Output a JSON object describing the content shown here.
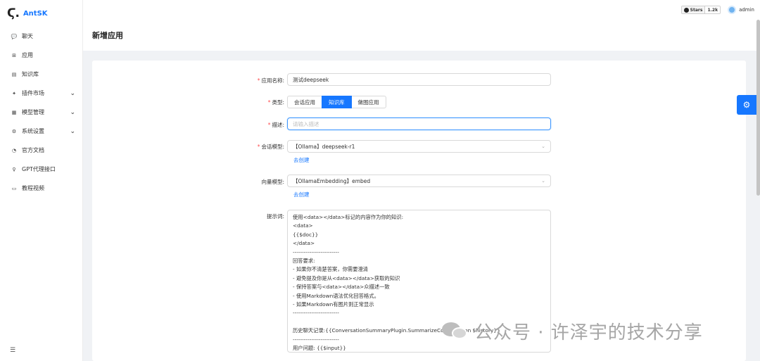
{
  "app": {
    "logo_mark": "Ϛ.",
    "name": "AntSK"
  },
  "sidebar": {
    "items": [
      {
        "icon": "chat-icon",
        "glyph": "💬",
        "label": "聊天",
        "expandable": false
      },
      {
        "icon": "app-icon",
        "glyph": "⊞",
        "label": "应用",
        "expandable": false
      },
      {
        "icon": "book-icon",
        "glyph": "▤",
        "label": "知识库",
        "expandable": false
      },
      {
        "icon": "plugin-icon",
        "glyph": "✦",
        "label": "插件市场",
        "expandable": true
      },
      {
        "icon": "model-icon",
        "glyph": "▦",
        "label": "模型管理",
        "expandable": true
      },
      {
        "icon": "gear-icon",
        "glyph": "⚙",
        "label": "系统设置",
        "expandable": true
      },
      {
        "icon": "doc-icon",
        "glyph": "◔",
        "label": "官方文档",
        "expandable": false
      },
      {
        "icon": "bulb-icon",
        "glyph": "♀",
        "label": "GPT代理接口",
        "expandable": false
      },
      {
        "icon": "video-icon",
        "glyph": "▭",
        "label": "教程视频",
        "expandable": false
      }
    ],
    "collapse_glyph": "☰"
  },
  "header": {
    "github": {
      "label": "Stars",
      "count": "1.2k"
    },
    "user": "admin"
  },
  "page": {
    "title": "新增应用"
  },
  "form": {
    "name": {
      "label": "应用名称:",
      "value": "测试deepseek"
    },
    "type": {
      "label": "类型:",
      "options": [
        "会话应用",
        "知识库",
        "做图应用"
      ],
      "selected": "知识库"
    },
    "desc": {
      "label": "描述:",
      "placeholder": "请输入描述"
    },
    "chat_model": {
      "label": "会话模型:",
      "value": "【Ollama】deepseek-r1",
      "create_link": "去创建"
    },
    "embed_model": {
      "label": "向量模型:",
      "value": "【OllamaEmbedding】embed",
      "create_link": "去创建"
    },
    "prompt": {
      "label": "提示词:",
      "value": "使用<data></data>标记的内容作为你的知识:\n<data>\n{{$doc}}\n</data>\n-------------------------\n回答要求:\n- 如果你不清楚答案，你需要澄清\n- 避免提及你是从<data></data>获取的知识\n- 保持答案与<data></data>众描述一致\n- 使用Markdown语法优化回答格式。\n- 如果Markdown有图片则正常显示\n-------------------------\n\n历史聊天记录:{{ConversationSummaryPlugin.SummarizeConversation $history}}\n-------------------------\n用户问题: {{$input}}"
    }
  },
  "watermark": {
    "text": "公众号 · 许泽宇的技术分享"
  },
  "colors": {
    "primary": "#1677ff",
    "required": "#ff4d4f"
  }
}
